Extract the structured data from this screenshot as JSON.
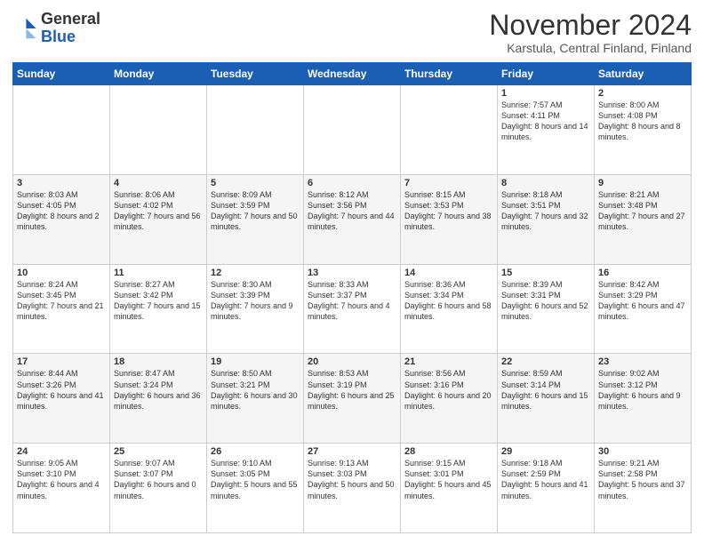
{
  "header": {
    "logo_general": "General",
    "logo_blue": "Blue",
    "month_title": "November 2024",
    "location": "Karstula, Central Finland, Finland"
  },
  "weekdays": [
    "Sunday",
    "Monday",
    "Tuesday",
    "Wednesday",
    "Thursday",
    "Friday",
    "Saturday"
  ],
  "weeks": [
    [
      {
        "day": "",
        "info": ""
      },
      {
        "day": "",
        "info": ""
      },
      {
        "day": "",
        "info": ""
      },
      {
        "day": "",
        "info": ""
      },
      {
        "day": "",
        "info": ""
      },
      {
        "day": "1",
        "info": "Sunrise: 7:57 AM\nSunset: 4:11 PM\nDaylight: 8 hours and 14 minutes."
      },
      {
        "day": "2",
        "info": "Sunrise: 8:00 AM\nSunset: 4:08 PM\nDaylight: 8 hours and 8 minutes."
      }
    ],
    [
      {
        "day": "3",
        "info": "Sunrise: 8:03 AM\nSunset: 4:05 PM\nDaylight: 8 hours and 2 minutes."
      },
      {
        "day": "4",
        "info": "Sunrise: 8:06 AM\nSunset: 4:02 PM\nDaylight: 7 hours and 56 minutes."
      },
      {
        "day": "5",
        "info": "Sunrise: 8:09 AM\nSunset: 3:59 PM\nDaylight: 7 hours and 50 minutes."
      },
      {
        "day": "6",
        "info": "Sunrise: 8:12 AM\nSunset: 3:56 PM\nDaylight: 7 hours and 44 minutes."
      },
      {
        "day": "7",
        "info": "Sunrise: 8:15 AM\nSunset: 3:53 PM\nDaylight: 7 hours and 38 minutes."
      },
      {
        "day": "8",
        "info": "Sunrise: 8:18 AM\nSunset: 3:51 PM\nDaylight: 7 hours and 32 minutes."
      },
      {
        "day": "9",
        "info": "Sunrise: 8:21 AM\nSunset: 3:48 PM\nDaylight: 7 hours and 27 minutes."
      }
    ],
    [
      {
        "day": "10",
        "info": "Sunrise: 8:24 AM\nSunset: 3:45 PM\nDaylight: 7 hours and 21 minutes."
      },
      {
        "day": "11",
        "info": "Sunrise: 8:27 AM\nSunset: 3:42 PM\nDaylight: 7 hours and 15 minutes."
      },
      {
        "day": "12",
        "info": "Sunrise: 8:30 AM\nSunset: 3:39 PM\nDaylight: 7 hours and 9 minutes."
      },
      {
        "day": "13",
        "info": "Sunrise: 8:33 AM\nSunset: 3:37 PM\nDaylight: 7 hours and 4 minutes."
      },
      {
        "day": "14",
        "info": "Sunrise: 8:36 AM\nSunset: 3:34 PM\nDaylight: 6 hours and 58 minutes."
      },
      {
        "day": "15",
        "info": "Sunrise: 8:39 AM\nSunset: 3:31 PM\nDaylight: 6 hours and 52 minutes."
      },
      {
        "day": "16",
        "info": "Sunrise: 8:42 AM\nSunset: 3:29 PM\nDaylight: 6 hours and 47 minutes."
      }
    ],
    [
      {
        "day": "17",
        "info": "Sunrise: 8:44 AM\nSunset: 3:26 PM\nDaylight: 6 hours and 41 minutes."
      },
      {
        "day": "18",
        "info": "Sunrise: 8:47 AM\nSunset: 3:24 PM\nDaylight: 6 hours and 36 minutes."
      },
      {
        "day": "19",
        "info": "Sunrise: 8:50 AM\nSunset: 3:21 PM\nDaylight: 6 hours and 30 minutes."
      },
      {
        "day": "20",
        "info": "Sunrise: 8:53 AM\nSunset: 3:19 PM\nDaylight: 6 hours and 25 minutes."
      },
      {
        "day": "21",
        "info": "Sunrise: 8:56 AM\nSunset: 3:16 PM\nDaylight: 6 hours and 20 minutes."
      },
      {
        "day": "22",
        "info": "Sunrise: 8:59 AM\nSunset: 3:14 PM\nDaylight: 6 hours and 15 minutes."
      },
      {
        "day": "23",
        "info": "Sunrise: 9:02 AM\nSunset: 3:12 PM\nDaylight: 6 hours and 9 minutes."
      }
    ],
    [
      {
        "day": "24",
        "info": "Sunrise: 9:05 AM\nSunset: 3:10 PM\nDaylight: 6 hours and 4 minutes."
      },
      {
        "day": "25",
        "info": "Sunrise: 9:07 AM\nSunset: 3:07 PM\nDaylight: 6 hours and 0 minutes."
      },
      {
        "day": "26",
        "info": "Sunrise: 9:10 AM\nSunset: 3:05 PM\nDaylight: 5 hours and 55 minutes."
      },
      {
        "day": "27",
        "info": "Sunrise: 9:13 AM\nSunset: 3:03 PM\nDaylight: 5 hours and 50 minutes."
      },
      {
        "day": "28",
        "info": "Sunrise: 9:15 AM\nSunset: 3:01 PM\nDaylight: 5 hours and 45 minutes."
      },
      {
        "day": "29",
        "info": "Sunrise: 9:18 AM\nSunset: 2:59 PM\nDaylight: 5 hours and 41 minutes."
      },
      {
        "day": "30",
        "info": "Sunrise: 9:21 AM\nSunset: 2:58 PM\nDaylight: 5 hours and 37 minutes."
      }
    ]
  ]
}
